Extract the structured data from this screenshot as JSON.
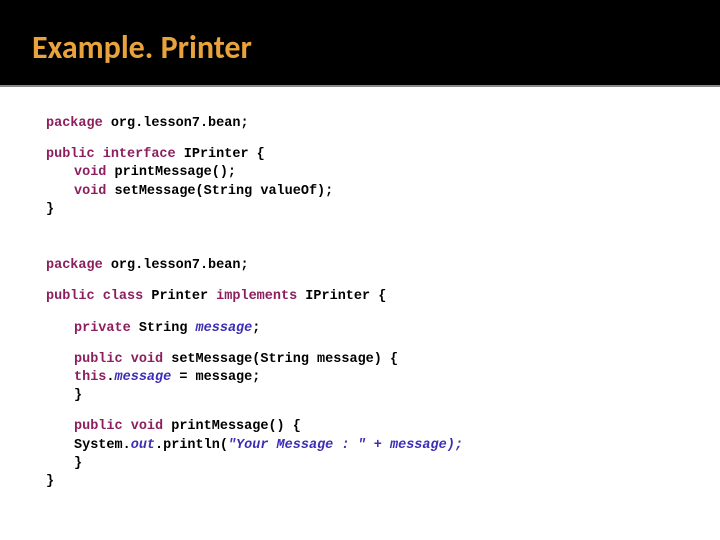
{
  "header": {
    "title": "Example. Printer"
  },
  "code": {
    "pkg_kw": "package",
    "pkg1": "org.lesson7.bean;",
    "pub_kw": "public",
    "iface_kw": "interface",
    "iface_name": "IPrinter {",
    "void_kw": "void",
    "m1": "printMessage();",
    "m2": "setMessage(String valueOf);",
    "close": "}",
    "pkg2": "org.lesson7.bean;",
    "class_kw": "class",
    "cls_name": "Printer",
    "impl_kw": "implements",
    "impl_name": "IPrinter {",
    "priv_kw": "private",
    "str_type": "String",
    "fld_decl_name": "message",
    "fld_decl_semi": ";",
    "setm_sig": "setMessage(String message) {",
    "this_kw": "this",
    "assign_dot": ".",
    "assign_lhs": "message",
    "assign_rest": " = message;",
    "printm_sig": "printMessage() {",
    "sys": "System.",
    "out": "out",
    "println_open": ".println(",
    "str_lit": "\"Your Message : \"",
    "plus": " + ",
    "msg_var": "message",
    "println_close": ");"
  }
}
